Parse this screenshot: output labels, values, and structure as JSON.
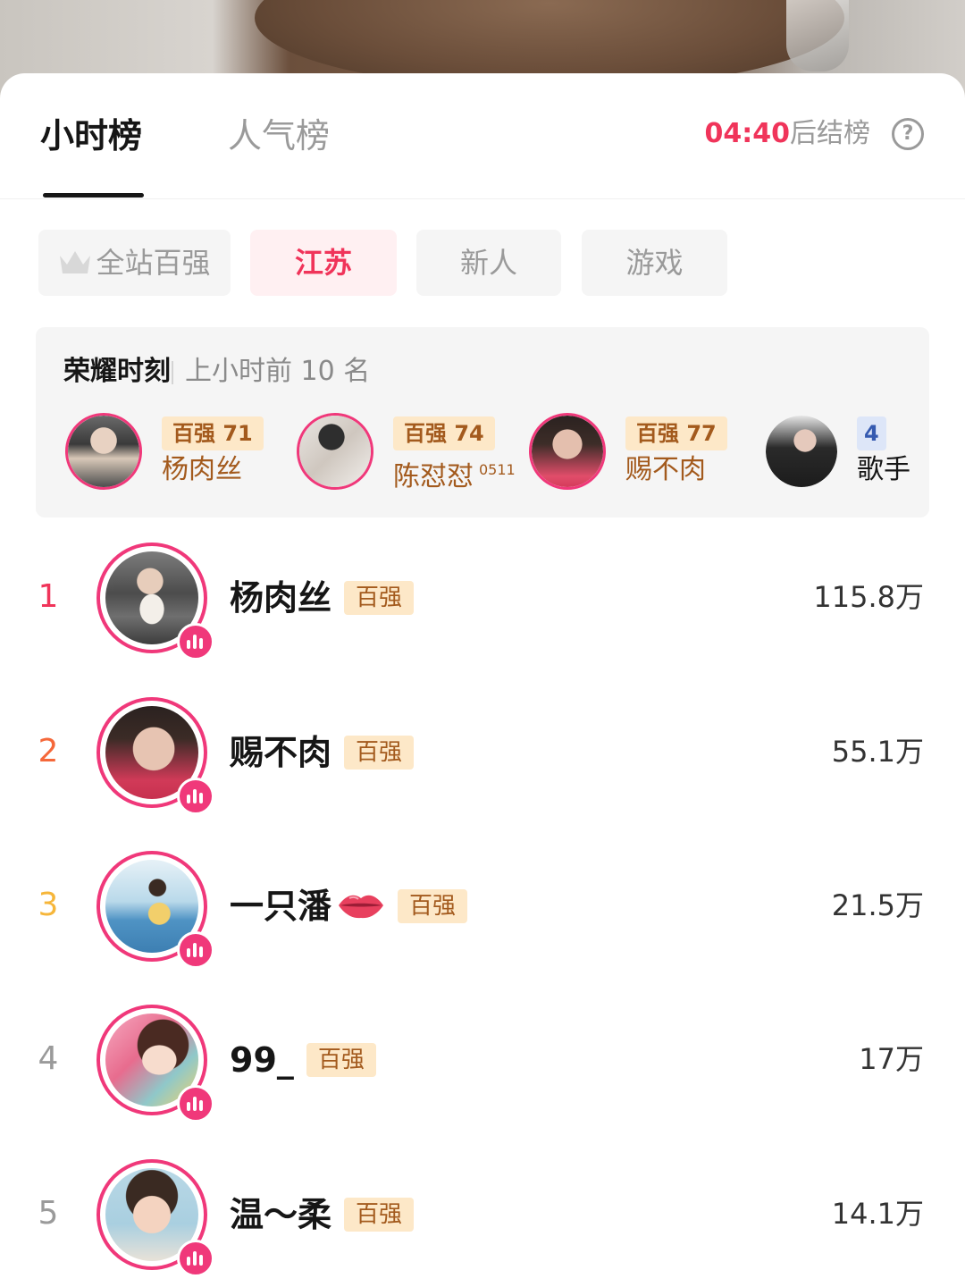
{
  "tabs": {
    "active": "小时榜",
    "inactive": "人气榜"
  },
  "countdown": {
    "time": "04:40",
    "suffix": "后结榜"
  },
  "filters": [
    "全站百强",
    "江苏",
    "新人",
    "游戏"
  ],
  "glory": {
    "title": "荣耀时刻",
    "subtitle": "上小时前 10 名",
    "items": [
      {
        "badge": "百强 71",
        "name": "杨肉丝",
        "suffix": ""
      },
      {
        "badge": "百强 74",
        "name": "陈怼怼",
        "suffix": "0511"
      },
      {
        "badge": "百强 77",
        "name": "赐不肉",
        "suffix": ""
      },
      {
        "badge": "4",
        "name": "歌手",
        "suffix": ""
      }
    ]
  },
  "ranking": [
    {
      "rank": "1",
      "name": "杨肉丝",
      "badge": "百强",
      "score": "115.8万"
    },
    {
      "rank": "2",
      "name": "赐不肉",
      "badge": "百强",
      "score": "55.1万"
    },
    {
      "rank": "3",
      "name": "一只潘",
      "badge": "百强",
      "score": "21.5万"
    },
    {
      "rank": "4",
      "name": "99_",
      "badge": "百强",
      "score": "17万"
    },
    {
      "rank": "5",
      "name": "温～柔",
      "badge": "百强",
      "score": "14.1万"
    }
  ],
  "colors": {
    "accent": "#f0345a",
    "ring": "#f0387a",
    "rank1": "#f0345a",
    "rank2": "#f5683a",
    "rank3": "#f6b63a",
    "rankOther": "#9a9a9a"
  }
}
